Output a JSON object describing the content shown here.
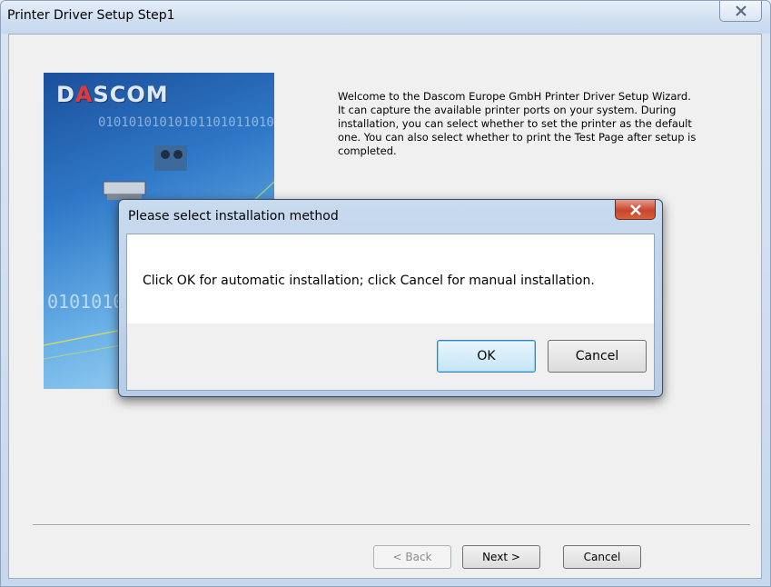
{
  "window": {
    "title": "Printer Driver Setup Step1",
    "close_icon": "close-icon"
  },
  "banner": {
    "logo": "DASCOM",
    "binary_top": "01010101010101101011010",
    "binary_bottom": "0101010"
  },
  "welcome_text": "Welcome to the Dascom Europe GmbH Printer Driver Setup Wizard. It can capture the available printer ports on your system. During installation, you can select whether to set the printer as the default one. You can also select whether to print the Test Page after setup is completed.",
  "wizard_buttons": {
    "back": "< Back",
    "next": "Next >",
    "cancel": "Cancel"
  },
  "dialog": {
    "title": "Please select installation method",
    "message": "Click OK for automatic installation; click Cancel for manual installation.",
    "ok": "OK",
    "cancel": "Cancel",
    "close_color": "#c8462c"
  }
}
